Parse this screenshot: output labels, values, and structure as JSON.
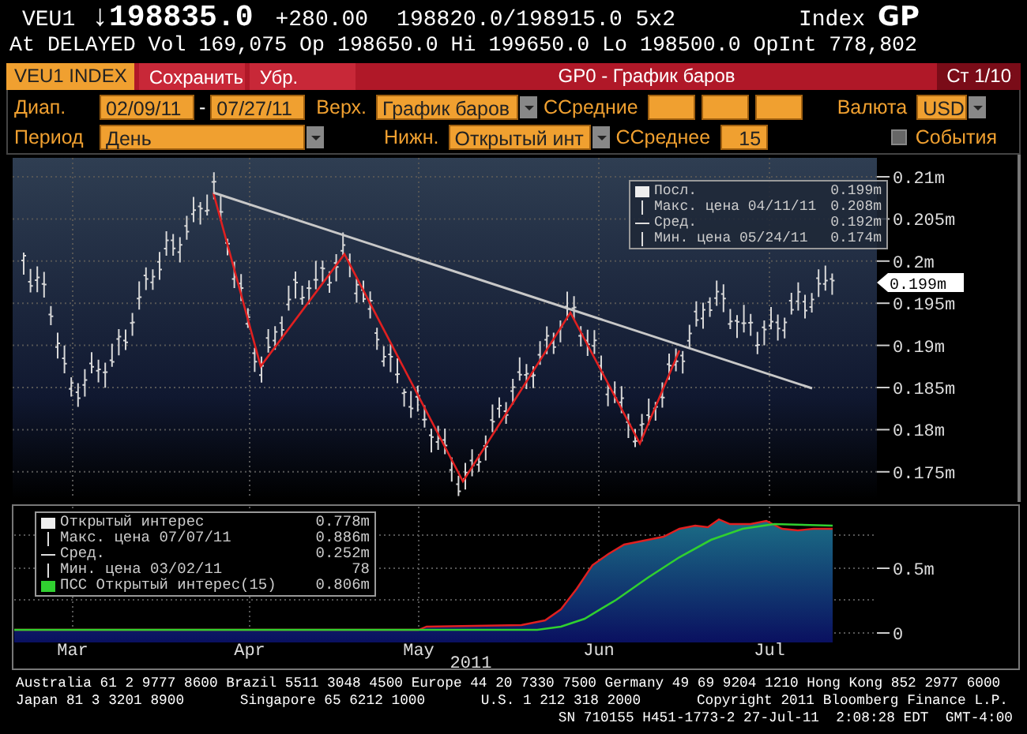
{
  "header": {
    "ticker": "VEU1",
    "arrow": "↓",
    "last": "198835.0",
    "change": "+280.00",
    "bid_ask": "198820.0/198915.0 5x2",
    "market": "Index",
    "function": "GP"
  },
  "quote_line": "At DELAYED Vol 169,075 Op 198650.0 Hi 199650.0 Lo 198500.0 OpInt 778,802",
  "toolbar": {
    "security": "VEU1 INDEX",
    "buttons": [
      "Сохранить",
      "Убр."
    ],
    "title": "GP0 - График баров",
    "page": "Ст 1/10"
  },
  "form": {
    "range_label": "Диап.",
    "range_from": "02/09/11",
    "range_sep": "-",
    "range_to": "07/27/11",
    "upper_label": "Верх.",
    "upper_value": "График баров",
    "ma_label": "ССредние",
    "currency_label": "Валюта",
    "currency_value": "USD",
    "period_label": "Период",
    "period_value": "День",
    "lower_label": "Нижн.",
    "lower_value": "Открытый инт",
    "ma2_label": "ССреднее",
    "ma2_value": "15",
    "events": {
      "label": "События",
      "checked": false
    }
  },
  "price_panel": {
    "legend": [
      {
        "kind": "box",
        "label": "Посл.",
        "value": "0.199m"
      },
      {
        "kind": "max",
        "label": "Макс. цена 04/11/11",
        "value": "0.208m"
      },
      {
        "kind": "avg",
        "label": "Сред.",
        "value": "0.192m"
      },
      {
        "kind": "min",
        "label": "Мин. цена 05/24/11",
        "value": "0.174m"
      }
    ],
    "y_labels": [
      "0.21m",
      "0.205m",
      "0.2m",
      "0.195m",
      "0.19m",
      "0.185m",
      "0.18m",
      "0.175m"
    ],
    "last_tag": "0.199m"
  },
  "volume_panel": {
    "legend": [
      {
        "kind": "box",
        "label": "Открытый интерес",
        "value": "0.778m"
      },
      {
        "kind": "max",
        "label": "Макс. цена 07/07/11",
        "value": "0.886m"
      },
      {
        "kind": "avg",
        "label": "Сред.",
        "value": "0.252m"
      },
      {
        "kind": "min",
        "label": "Мин. цена 03/02/11",
        "value": "78"
      },
      {
        "kind": "green",
        "label": "ПСС Открытый интерес(15)",
        "value": "0.806m"
      }
    ],
    "y_labels": [
      "0.5m",
      "0"
    ]
  },
  "x_axis": {
    "months": [
      "Mar",
      "Apr",
      "May",
      "Jun",
      "Jul"
    ],
    "year": "2011"
  },
  "footer": {
    "line_1": "Australia 61 2 9777 8600 Brazil 5511 3048 4500 Europe 44 20 7330 7500 Germany 49 69 9204 1210 Hong Kong 852 2977 6000",
    "line_2": [
      "Japan 81 3 3201 8900",
      "Singapore 65 6212 1000",
      "U.S. 1 212 318 2000",
      "Copyright 2011 Bloomberg Finance L.P."
    ],
    "line_3": "SN 710155 H451-1773-2 27-Jul-11  2:08:28 EDT  GMT-4:00"
  }
}
